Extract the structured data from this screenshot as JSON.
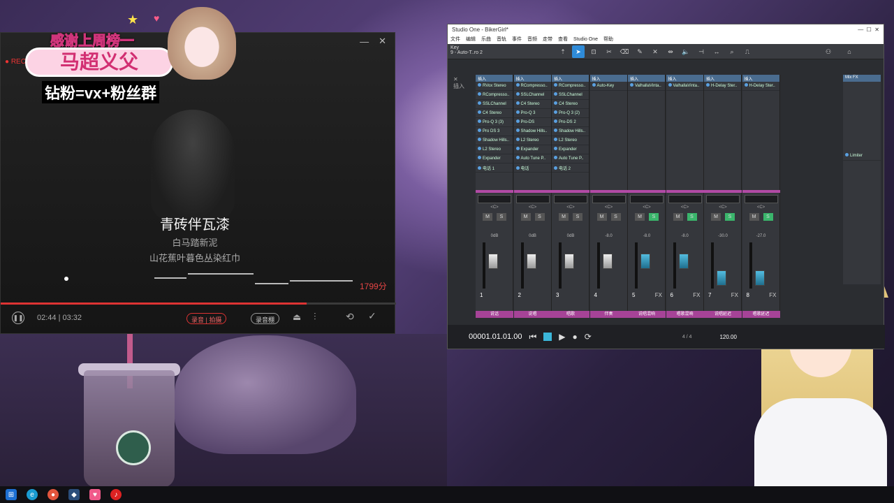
{
  "karaoke": {
    "lyric_current": "青砖伴瓦漆",
    "lyric_next": "白马踏新泥",
    "lyric_after": "山花蕉叶暮色丛染红巾",
    "score": "1799分",
    "time": "02:44 | 03:32",
    "rec_label": "REC",
    "btn_record": "录音 | 拍摄",
    "btn_effect": "录音棚",
    "progress_fraction": 0.774,
    "minimize": "—",
    "close": "✕"
  },
  "overlay": {
    "thanks": "感谢上周榜一",
    "name_box": "马超义父",
    "fans": "钻粉=vx+粉丝群"
  },
  "studio": {
    "title": "Studio One - BikerGirl*",
    "menu": [
      "文件",
      "编辑",
      "乐曲",
      "音轨",
      "事件",
      "音频",
      "走带",
      "查看",
      "Studio One",
      "帮助"
    ],
    "track_name": "Key",
    "track_sub": "9 - Auto-T..ro 2",
    "insert_label": "插入",
    "channels": [
      {
        "num": "1",
        "name": "说话",
        "db": "0dB",
        "inserts": [
          "RVox Stereo",
          "RCompresso..",
          "SSLChannel",
          "C4 Stereo",
          "Pro-Q 3 (3)",
          "Pro DS 3",
          "Shadow Hills..",
          "L2 Stereo",
          "Expander",
          "电话 1"
        ]
      },
      {
        "num": "2",
        "name": "说唱",
        "db": "0dB",
        "inserts": [
          "RCompresso..",
          "SSLChannel",
          "C4 Stereo",
          "Pro-Q 3",
          "Pro-DS",
          "Shadow Hills..",
          "L2 Stereo",
          "Expander",
          "Auto Tune P..",
          "电话"
        ]
      },
      {
        "num": "3",
        "name": "唱歌",
        "db": "0dB",
        "inserts": [
          "RCompresso..",
          "SSLChannel",
          "C4 Stereo",
          "Pro-Q 3 (2)",
          "Pro-DS 2",
          "Shadow Hills..",
          "L2 Stereo",
          "Expander",
          "Auto Tune P..",
          "电话 2"
        ]
      },
      {
        "num": "4",
        "name": "伴奏",
        "db": "-8.0",
        "inserts": [
          "Auto-Key"
        ]
      },
      {
        "num": "5",
        "name": "说唱混响",
        "db": "-8.0",
        "inserts": [
          "ValhallaVinta.."
        ]
      },
      {
        "num": "6",
        "name": "唱歌混响",
        "db": "-8.0",
        "inserts": [
          "ValhallaVinta.."
        ]
      },
      {
        "num": "7",
        "name": "说唱延迟",
        "db": "-30.0",
        "inserts": [
          "H-Delay Ster.."
        ]
      },
      {
        "num": "8",
        "name": "唱歌延迟",
        "db": "-27.0",
        "inserts": [
          "H-Delay Ster.."
        ]
      }
    ],
    "mix_fx": "Mix FX",
    "master_inserts": [
      "Limiter"
    ],
    "time_display": "00001.01.01.00",
    "time_sig": "4 / 4",
    "tempo": "120.00",
    "pan_label": "<C>",
    "m_label": "M",
    "s_label": "S",
    "fx_label": "FX"
  },
  "colors": {
    "accent_red": "#e64545",
    "s1_blue": "#2f8bd8",
    "s1_purple": "#a64397",
    "s1_green": "#3ab56b"
  }
}
